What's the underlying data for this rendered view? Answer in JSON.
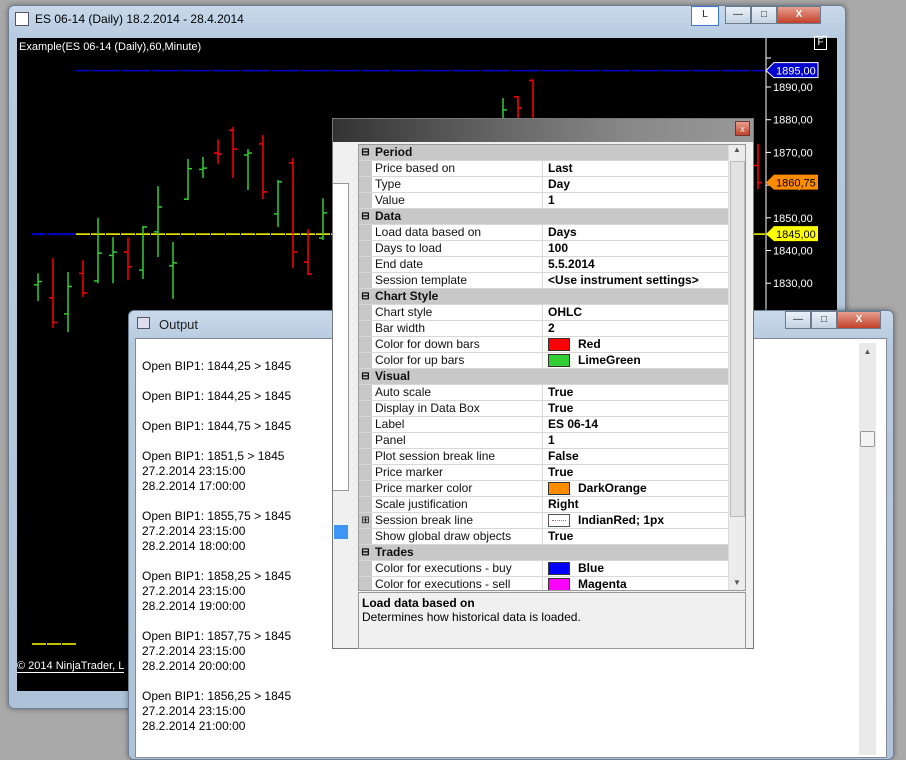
{
  "main_window": {
    "title": "ES 06-14 (Daily)  18.2.2014 - 28.4.2014",
    "link_button": "L",
    "minimize": "—",
    "maximize": "□",
    "close": "X"
  },
  "chart": {
    "title": "Example(ES 06-14 (Daily),60,Minute)",
    "f_button": "F",
    "copyright": "© 2014 NinjaTrader, L",
    "type": "ohlc",
    "up_color": "#32cd32",
    "down_color": "#ff0000",
    "price_axis": {
      "ticks": [
        "1890,00",
        "1880,00",
        "1870,00",
        "1860,00",
        "1850,00",
        "1840,00",
        "1830,00"
      ],
      "tick_values": [
        1890,
        1880,
        1870,
        1860,
        1850,
        1840,
        1830
      ]
    },
    "lines": [
      {
        "price": 1895,
        "color": "#0000cd",
        "label": "1895,00"
      },
      {
        "price": 1845,
        "color": "#ffff00",
        "label": "1845,00"
      }
    ],
    "last_price_marker": {
      "price": 1860.75,
      "label": "1860,75",
      "color": "#ff8c00"
    },
    "bars": [
      {
        "i": 0,
        "o": 1829.5,
        "h": 1833,
        "l": 1824.5,
        "c": 1830.5
      },
      {
        "i": 1,
        "o": 1825.5,
        "h": 1837.7,
        "l": 1816.3,
        "c": 1818
      },
      {
        "i": 2,
        "o": 1820.6,
        "h": 1833.4,
        "l": 1815,
        "c": 1829
      },
      {
        "i": 3,
        "o": 1833,
        "h": 1837,
        "l": 1825.8,
        "c": 1827
      },
      {
        "i": 4,
        "o": 1830.7,
        "h": 1850,
        "l": 1830,
        "c": 1839.2
      },
      {
        "i": 5,
        "o": 1838.5,
        "h": 1844.1,
        "l": 1830,
        "c": 1839.5
      },
      {
        "i": 6,
        "o": 1839.5,
        "h": 1844,
        "l": 1831,
        "c": 1835
      },
      {
        "i": 7,
        "o": 1834,
        "h": 1847.5,
        "l": 1831.3,
        "c": 1847.2
      },
      {
        "i": 8,
        "o": 1845.7,
        "h": 1859.7,
        "l": 1838,
        "c": 1853.3
      },
      {
        "i": 9,
        "o": 1835.3,
        "h": 1842.6,
        "l": 1825.2,
        "c": 1836.2
      },
      {
        "i": 10,
        "o": 1855.7,
        "h": 1868,
        "l": 1855.4,
        "c": 1865
      },
      {
        "i": 11,
        "o": 1864.8,
        "h": 1868.6,
        "l": 1862.2,
        "c": 1865.2
      },
      {
        "i": 12,
        "o": 1869.8,
        "h": 1874,
        "l": 1866.5,
        "c": 1869.5
      },
      {
        "i": 13,
        "o": 1876.8,
        "h": 1877.8,
        "l": 1862.2,
        "c": 1871
      },
      {
        "i": 14,
        "o": 1869.2,
        "h": 1871,
        "l": 1858.5,
        "c": 1869.8
      },
      {
        "i": 15,
        "o": 1872.6,
        "h": 1875.3,
        "l": 1855.7,
        "c": 1857.9
      },
      {
        "i": 16,
        "o": 1851.2,
        "h": 1861.6,
        "l": 1847.2,
        "c": 1861
      },
      {
        "i": 17,
        "o": 1866.8,
        "h": 1868.3,
        "l": 1834.6,
        "c": 1839.5
      },
      {
        "i": 18,
        "o": 1836.5,
        "h": 1846.6,
        "l": 1832.5,
        "c": 1832.8
      },
      {
        "i": 19,
        "o": 1843.8,
        "h": 1856,
        "l": 1843.2,
        "c": 1851.5
      },
      {
        "i": 31,
        "o": 1875,
        "h": 1886.6,
        "l": 1870,
        "c": 1883
      },
      {
        "i": 32,
        "o": 1887,
        "h": 1887.2,
        "l": 1870,
        "c": 1883.6
      },
      {
        "i": 33,
        "o": 1892,
        "h": 1892.4,
        "l": 1870,
        "c": 1872
      },
      {
        "i": 48,
        "o": 1866,
        "h": 1872.6,
        "l": 1858.8,
        "c": 1860.75
      }
    ]
  },
  "output_window": {
    "title": "Output",
    "entries": [
      [
        "Open BIP1: 1844,25 > 1845"
      ],
      [
        "Open BIP1: 1844,25 > 1845"
      ],
      [
        "Open BIP1: 1844,75 > 1845"
      ],
      [
        "Open BIP1: 1851,5 > 1845",
        "27.2.2014 23:15:00",
        "28.2.2014 17:00:00"
      ],
      [
        "Open BIP1: 1855,75 > 1845",
        "27.2.2014 23:15:00",
        "28.2.2014 18:00:00"
      ],
      [
        "Open BIP1: 1858,25 > 1845",
        "27.2.2014 23:15:00",
        "28.2.2014 19:00:00"
      ],
      [
        "Open BIP1: 1857,75 > 1845",
        "27.2.2014 23:15:00",
        "28.2.2014 20:00:00"
      ],
      [
        "Open BIP1: 1856,25 > 1845",
        "27.2.2014 23:15:00",
        "28.2.2014 21:00:00"
      ]
    ]
  },
  "properties": {
    "close": "x",
    "rows": [
      {
        "header": "Period",
        "expander": "⊟"
      },
      {
        "name": "Price based on",
        "value": "Last"
      },
      {
        "name": "Type",
        "value": "Day"
      },
      {
        "name": "Value",
        "value": "1"
      },
      {
        "header": "Data",
        "expander": "⊟"
      },
      {
        "name": "Load data based on",
        "value": "Days"
      },
      {
        "name": "Days to load",
        "value": "100"
      },
      {
        "name": "End date",
        "value": "5.5.2014"
      },
      {
        "name": "Session template",
        "value": "<Use instrument settings>"
      },
      {
        "header": "Chart Style",
        "expander": "⊟"
      },
      {
        "name": "Chart style",
        "value": "OHLC"
      },
      {
        "name": "Bar width",
        "value": "2"
      },
      {
        "name": "Color for down bars",
        "value": "Red",
        "swatch": "#ff0000"
      },
      {
        "name": "Color for up bars",
        "value": "LimeGreen",
        "swatch": "#32cd32"
      },
      {
        "header": "Visual",
        "expander": "⊟"
      },
      {
        "name": "Auto scale",
        "value": "True"
      },
      {
        "name": "Display in Data Box",
        "value": "True"
      },
      {
        "name": "Label",
        "value": "ES 06-14"
      },
      {
        "name": "Panel",
        "value": "1"
      },
      {
        "name": "Plot session break line",
        "value": "False"
      },
      {
        "name": "Price marker",
        "value": "True"
      },
      {
        "name": "Price marker color",
        "value": "DarkOrange",
        "swatch": "#ff8c00"
      },
      {
        "name": "Scale justification",
        "value": "Right"
      },
      {
        "name": "Session break line",
        "value": "IndianRed; 1px",
        "swatch": "dotted",
        "expander": "⊞"
      },
      {
        "name": "Show global draw objects",
        "value": "True"
      },
      {
        "header": "Trades",
        "expander": "⊟"
      },
      {
        "name": "Color for executions - buy",
        "value": "Blue",
        "swatch": "#0000ff"
      },
      {
        "name": "Color for executions - sell",
        "value": "Magenta",
        "swatch": "#ff00ff"
      }
    ],
    "description": {
      "title": "Load data based on",
      "text": "Determines how historical data is loaded."
    }
  }
}
